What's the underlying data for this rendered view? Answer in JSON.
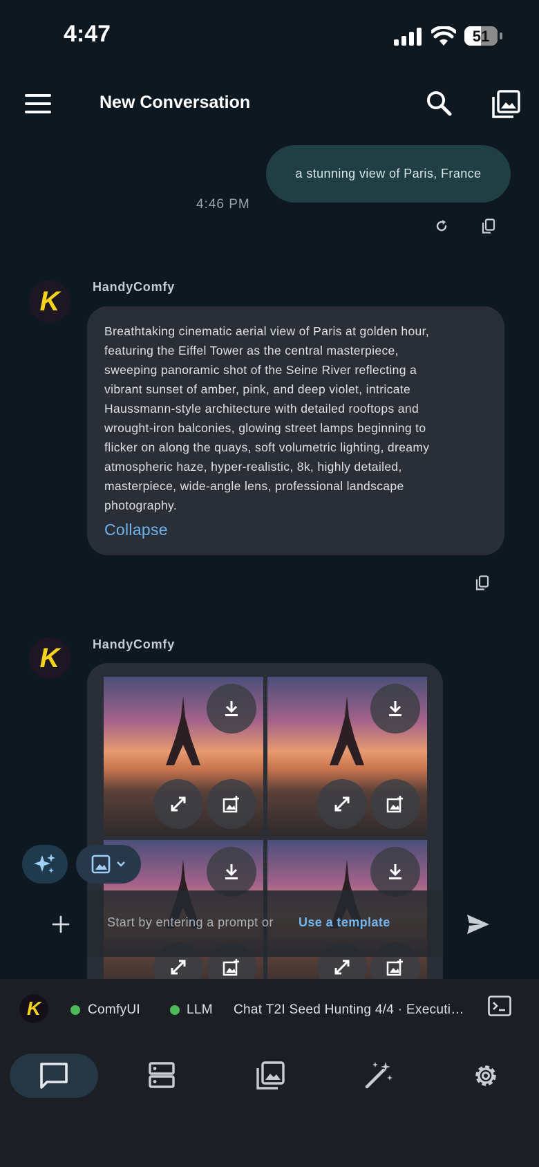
{
  "status_bar": {
    "time": "4:47",
    "battery_level": "51",
    "battery_fraction": 0.51
  },
  "header": {
    "title": "New Conversation",
    "icons": [
      "menu-icon",
      "search-icon",
      "gallery-icon"
    ]
  },
  "user_message": {
    "text": "a stunning view of Paris, France",
    "timestamp": "4:46 PM",
    "actions": [
      "retry-icon",
      "copy-icon"
    ]
  },
  "assistant_messages": [
    {
      "sender": "HandyComfy",
      "avatar_letter": "K",
      "lines": [
        "Breathtaking cinematic aerial view of Paris at golden hour,",
        "featuring the Eiffel Tower as the central masterpiece,",
        "sweeping panoramic shot of the Seine River reflecting a",
        "vibrant sunset of amber, pink, and deep violet, intricate",
        "Haussmann-style architecture with detailed rooftops and",
        "wrought-iron balconies, glowing street lamps beginning to",
        "flicker on along the quays, soft volumetric lighting, dreamy",
        "atmospheric haze, hyper-realistic, 8k, highly detailed,",
        "masterpiece, wide-angle lens, professional landscape",
        "photography."
      ],
      "collapse_label": "Collapse"
    },
    {
      "sender": "HandyComfy",
      "avatar_letter": "K",
      "images": [
        {
          "subject": "Eiffel Tower sunset"
        },
        {
          "subject": "Eiffel Tower sunset"
        },
        {
          "subject": "Eiffel Tower sunset"
        },
        {
          "subject": "Eiffel Tower sunset"
        }
      ],
      "image_actions": [
        "download-icon",
        "expand-icon",
        "add-image-icon"
      ]
    }
  ],
  "input": {
    "placeholder": "Start by entering a prompt or",
    "template_link": "Use a template"
  },
  "status_strip": {
    "logo_letter": "K",
    "items": [
      {
        "label": "ComfyUI",
        "status_color": "#4cba58"
      },
      {
        "label": "LLM",
        "status_color": "#4cba58"
      }
    ],
    "task": "Chat T2I Seed Hunting 4/4 · Executi…"
  },
  "bottom_nav": {
    "items": [
      "chat",
      "servers",
      "gallery",
      "magic",
      "settings"
    ],
    "active": "chat"
  },
  "colors": {
    "background": "#0e1821",
    "accent": "#72b6ef",
    "user_bubble": "#1f3f44",
    "ai_bubble": "#2a2f37"
  }
}
